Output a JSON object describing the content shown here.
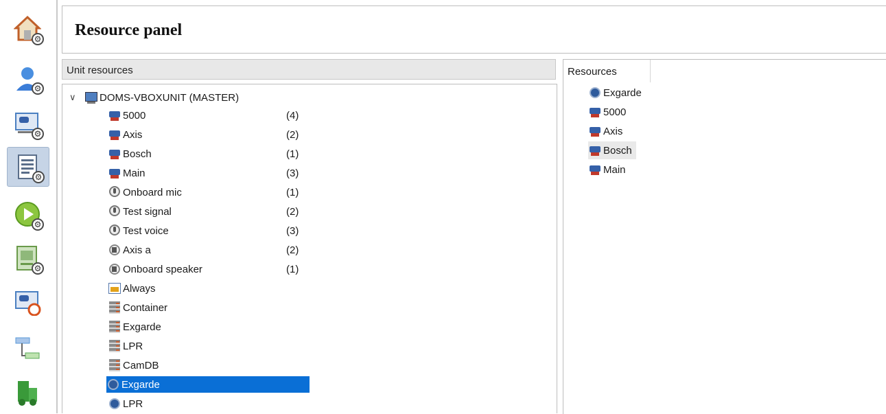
{
  "header": {
    "title": "Resource panel"
  },
  "sidebar": {
    "items": [
      {
        "name": "home-settings",
        "color": "#d2691e"
      },
      {
        "name": "user-settings",
        "color": "#3b7dd8"
      },
      {
        "name": "camera-settings",
        "color": "#4a7fc1"
      },
      {
        "name": "resource-panel",
        "color": "#5a6e8a"
      },
      {
        "name": "playback-settings",
        "color": "#8cc63f"
      },
      {
        "name": "device-settings",
        "color": "#6a9a4a"
      },
      {
        "name": "camera-support",
        "color": "#4a7fc1"
      },
      {
        "name": "network-settings",
        "color": "#5a9ad8"
      },
      {
        "name": "site-settings",
        "color": "#3a9a3a"
      }
    ]
  },
  "unit_resources": {
    "header": "Unit resources",
    "root": {
      "label": "DOMS-VBOXUNIT (MASTER)",
      "icon": "unit-icon"
    },
    "items": [
      {
        "label": "5000",
        "count": "(4)",
        "icon": "camera-icon"
      },
      {
        "label": "Axis",
        "count": "(2)",
        "icon": "camera-icon"
      },
      {
        "label": "Bosch",
        "count": "(1)",
        "icon": "camera-icon"
      },
      {
        "label": "Main",
        "count": "(3)",
        "icon": "camera-icon"
      },
      {
        "label": "Onboard mic",
        "count": "(1)",
        "icon": "microphone-icon"
      },
      {
        "label": "Test signal",
        "count": "(2)",
        "icon": "microphone-icon"
      },
      {
        "label": "Test voice",
        "count": "(3)",
        "icon": "microphone-icon"
      },
      {
        "label": "Axis a",
        "count": "(2)",
        "icon": "speaker-icon"
      },
      {
        "label": "Onboard speaker",
        "count": "(1)",
        "icon": "speaker-icon"
      },
      {
        "label": "Always",
        "count": "",
        "icon": "schedule-icon"
      },
      {
        "label": "Container",
        "count": "",
        "icon": "server-icon"
      },
      {
        "label": "Exgarde",
        "count": "",
        "icon": "server-icon"
      },
      {
        "label": "LPR",
        "count": "",
        "icon": "server-icon"
      },
      {
        "label": "CamDB",
        "count": "",
        "icon": "server-icon"
      },
      {
        "label": "Exgarde",
        "count": "",
        "icon": "door-icon",
        "selected": true
      },
      {
        "label": "LPR",
        "count": "",
        "icon": "door-icon"
      }
    ],
    "selection_color": "#0a6fd6"
  },
  "resources": {
    "tab": "Resources",
    "items": [
      {
        "label": "Exgarde",
        "icon": "door-icon"
      },
      {
        "label": "5000",
        "icon": "camera-icon"
      },
      {
        "label": "Axis",
        "icon": "camera-icon"
      },
      {
        "label": "Bosch",
        "icon": "camera-icon",
        "highlighted": true
      },
      {
        "label": "Main",
        "icon": "camera-icon"
      }
    ]
  }
}
